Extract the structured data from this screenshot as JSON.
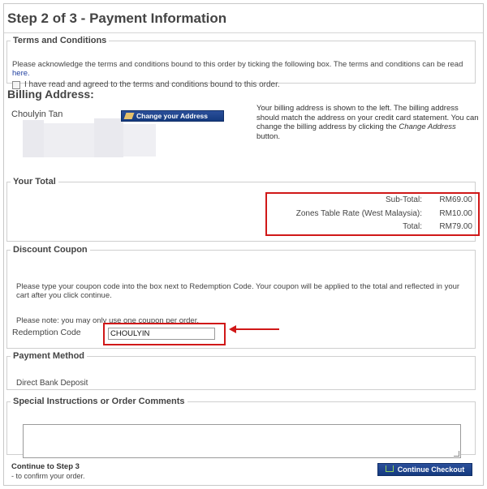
{
  "page": {
    "title": "Step 2 of 3 - Payment Information"
  },
  "terms": {
    "legend": "Terms and Conditions",
    "text": "Please acknowledge the terms and conditions bound to this order by ticking the following box. The terms and conditions can be read",
    "link": "here.",
    "checkbox_label": "I have read and agreed to the terms and conditions bound to this order."
  },
  "billing": {
    "title": "Billing Address:",
    "name": "Choulyin Tan",
    "change_button": "Change your Address",
    "note_part1": "Your billing address is shown to the left. The billing address should match the address on your credit card statement. You can change the billing address by clicking the",
    "note_emphasis": "Change Address",
    "note_part2": "button."
  },
  "total": {
    "legend": "Your Total",
    "rows": [
      {
        "label": "Sub-Total:",
        "value": "RM69.00"
      },
      {
        "label": "Zones Table Rate (West Malaysia):",
        "value": "RM10.00"
      },
      {
        "label": "Total:",
        "value": "RM79.00"
      }
    ]
  },
  "coupon": {
    "legend": "Discount Coupon",
    "text": "Please type your coupon code into the box next to Redemption Code. Your coupon will be applied to the total and reflected in your cart after you click continue.",
    "note": "Please note: you may only use one coupon per order.",
    "redemption_label": "Redemption Code",
    "redemption_value": "CHOULYIN"
  },
  "payment": {
    "legend": "Payment Method",
    "value": "Direct Bank Deposit"
  },
  "comments": {
    "legend": "Special Instructions or Order Comments",
    "value": ""
  },
  "footer": {
    "continue_title": "Continue to Step 3",
    "continue_sub": "- to confirm your order.",
    "checkout_button": "Continue Checkout"
  },
  "colors": {
    "highlight": "#d01818",
    "button": "#1d4288"
  }
}
